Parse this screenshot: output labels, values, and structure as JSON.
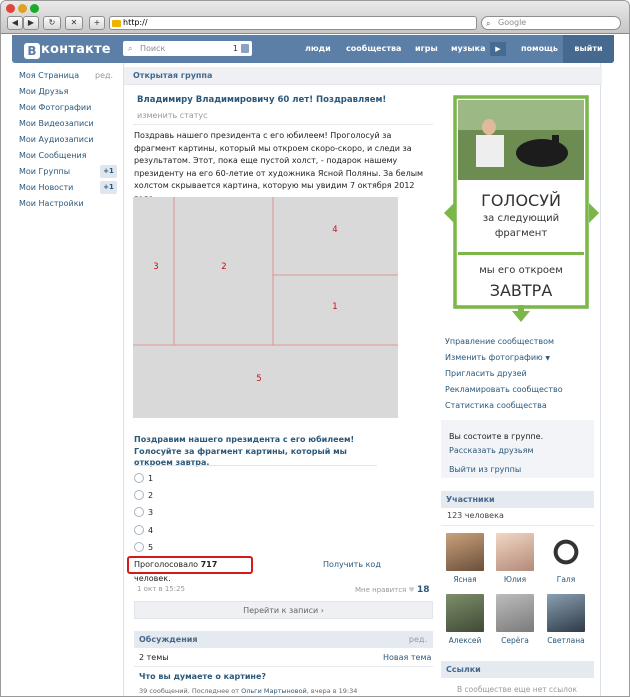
{
  "browser": {
    "url": "http://",
    "search_placeholder": "Google",
    "back": "◀",
    "forward": "▶",
    "reload": "↻",
    "add": "+"
  },
  "header": {
    "logo_letter": "В",
    "logo_text": "контакте",
    "search_placeholder": "Поиск",
    "search_count": "1",
    "nav": [
      "люди",
      "сообщества",
      "игры",
      "музыка",
      "помощь"
    ],
    "logout": "выйти"
  },
  "sidebar": {
    "items": [
      {
        "label": "Моя Страница",
        "extra": "ред."
      },
      {
        "label": "Мои Друзья"
      },
      {
        "label": "Мои Фотографии"
      },
      {
        "label": "Мои Видеозаписи"
      },
      {
        "label": "Мои Аудиозаписи"
      },
      {
        "label": "Мои Сообщения"
      },
      {
        "label": "Мои Группы",
        "badge": "+1"
      },
      {
        "label": "Мои Новости",
        "badge": "+1"
      },
      {
        "label": "Мои Настройки"
      }
    ]
  },
  "group": {
    "type_label": "Открытая группа",
    "title": "Владимиру Владимировичу 60 лет! Поздравляем!",
    "change_status": "изменить статус",
    "description": "Поздравь нашего президента с его юбилеем! Проголосуй за фрагмент картины, который мы откроем скоро-скоро, и следи за результатом. Этот, пока еще пустой холст, - подарок нашему президенту на его 60-летие от художника Ясной Поляны. За белым холстом скрывается картина, которую мы увидим 7 октября 2012 года.",
    "canvas_fragments": [
      "3",
      "2",
      "4",
      "1",
      "5"
    ]
  },
  "poll": {
    "question": "Поздравим нашего президента с его юбилеем! Голосуйте за фрагмент картины, который мы откроем завтра.",
    "options": [
      "1",
      "2",
      "3",
      "4",
      "5"
    ],
    "voted_prefix": "Проголосовало",
    "voted_count": "717",
    "voted_suffix": "человек.",
    "get_code": "Получить код"
  },
  "post": {
    "date": "1 окт в 15:25",
    "like_label": "Мне нравится",
    "like_count": "18",
    "goto": "Перейти к записи"
  },
  "discussions": {
    "title": "Обсуждения",
    "edit": "ред.",
    "count": "2 темы",
    "new_topic": "Новая тема",
    "topic_title": "Что вы думаете о картине?",
    "topic_meta_prefix": "39 сообщений. Последнее от",
    "topic_meta_author": "Ольги Мартыновой",
    "topic_meta_suffix": ", вчера в 19:34"
  },
  "banner": {
    "line1": "ГОЛОСУЙ",
    "line2": "за следующий",
    "line3": "фрагмент",
    "line4": "мы его откроем",
    "line5": "ЗАВТРА",
    "accent_color": "#7ab648"
  },
  "admin_links": [
    "Управление сообществом",
    "Изменить фотографию",
    "Пригласить друзей",
    "Рекламировать сообщество",
    "Статистика сообщества"
  ],
  "membership": {
    "status": "Вы состоите в группе.",
    "tell": "Рассказать друзьям",
    "leave": "Выйти из группы"
  },
  "members": {
    "title": "Участники",
    "count": "123 человека",
    "people": [
      "Ясная",
      "Юлия",
      "Галя",
      "Алексей",
      "Серёга",
      "Светлана"
    ]
  },
  "links": {
    "title": "Ссылки",
    "empty": "В сообществе еще нет ссылок"
  }
}
